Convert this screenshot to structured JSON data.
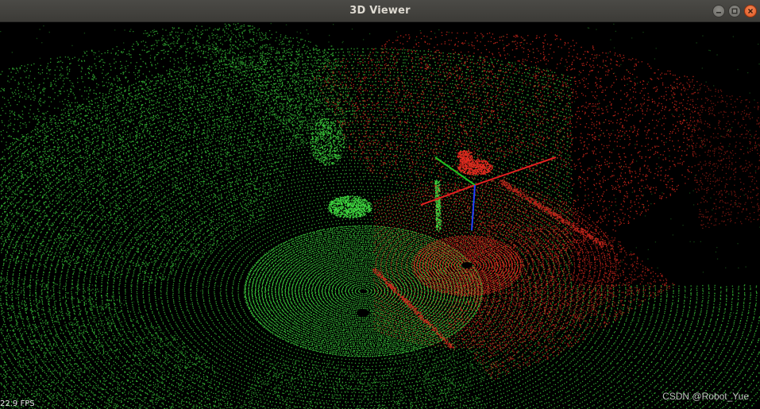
{
  "window": {
    "title": "3D Viewer"
  },
  "icons": {
    "minimize": "minimize-icon",
    "maximize": "maximize-icon",
    "close": "close-icon"
  },
  "viewport": {
    "fps_text": "22.9 FPS",
    "watermark": "CSDN @Robot_Yue"
  },
  "colors": {
    "background": "#000000",
    "cloud_green": "#3fd83f",
    "cloud_red": "#e02a1e",
    "axis_x": "#e02020",
    "axis_y": "#20c020",
    "axis_z": "#2040ff",
    "titlebar": "#3c3b37",
    "close_button": "#e0531c"
  }
}
